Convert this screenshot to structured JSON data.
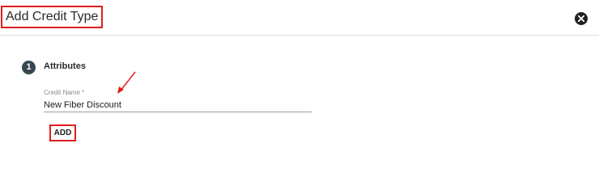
{
  "header": {
    "title": "Add Credit Type"
  },
  "icons": {
    "close": "close-circle-icon",
    "annotation": "red-arrow-icon"
  },
  "colors": {
    "highlight": "#e01e1e",
    "step_badge": "#37474f"
  },
  "step": {
    "number": "1",
    "title": "Attributes"
  },
  "form": {
    "credit_name": {
      "label": "Credit Name *",
      "value": "New Fiber Discount"
    },
    "add_label": "ADD"
  }
}
